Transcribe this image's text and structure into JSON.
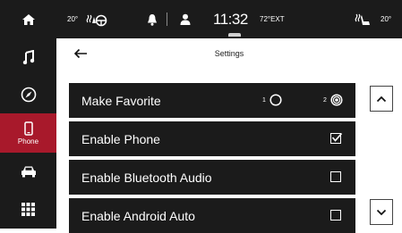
{
  "sidebar": {
    "items": [
      {
        "icon": "home-icon",
        "label": ""
      },
      {
        "icon": "music-note-icon",
        "label": ""
      },
      {
        "icon": "compass-icon",
        "label": ""
      },
      {
        "icon": "phone-icon",
        "label": "Phone",
        "active": true
      },
      {
        "icon": "car-icon",
        "label": ""
      },
      {
        "icon": "apps-grid-icon",
        "label": ""
      }
    ]
  },
  "status_bar": {
    "driver_temp": "20°",
    "passenger_temp": "20°",
    "clock": "11:32",
    "exterior_temp": "72°EXT",
    "icons": [
      "heated-steering-seat-icon",
      "bell-icon",
      "user-profile-icon",
      "heated-seat-icon"
    ]
  },
  "header": {
    "title": "Settings",
    "back_icon": "back-arrow-icon"
  },
  "settings": {
    "make_favorite": {
      "label": "Make Favorite",
      "option_1": "1",
      "option_2": "2",
      "selected": "2"
    },
    "rows": [
      {
        "label": "Enable Phone",
        "checked": true
      },
      {
        "label": "Enable Bluetooth Audio",
        "checked": false
      },
      {
        "label": "Enable Android Auto",
        "checked": false
      }
    ]
  },
  "scroll": {
    "up_icon": "chevron-up-icon",
    "down_icon": "chevron-down-icon"
  },
  "colors": {
    "bar_background": "#1b1b1b",
    "active_accent": "#a8192b",
    "content_background": "#ffffff",
    "text_on_dark": "#ffffff"
  }
}
